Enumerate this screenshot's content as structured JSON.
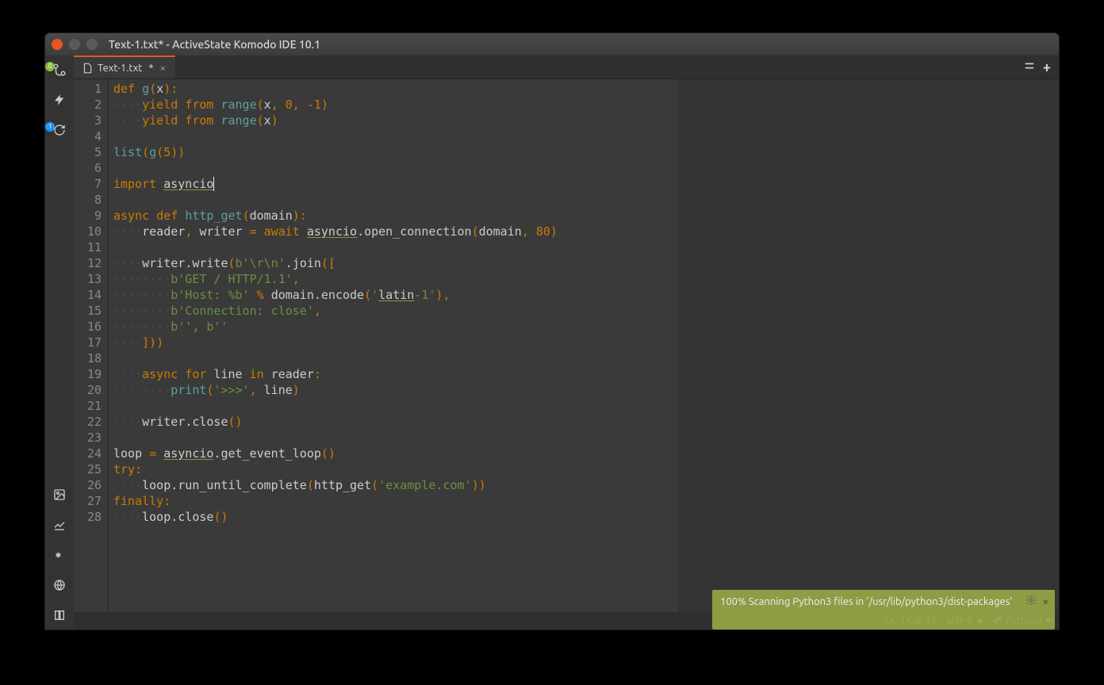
{
  "window": {
    "title": "Text-1.txt* - ActiveState Komodo IDE 10.1"
  },
  "tab": {
    "filename": "Text-1.txt",
    "modified_marker": "*"
  },
  "sidebar": {
    "vcs_badge": "0",
    "notifications_badge": "1"
  },
  "code": {
    "lines": [
      {
        "n": 1,
        "tokens": [
          [
            "kw",
            "def"
          ],
          [
            "plain",
            " "
          ],
          [
            "fn",
            "g"
          ],
          [
            "punc",
            "("
          ],
          [
            "name",
            "x"
          ],
          [
            "punc",
            ")"
          ],
          [
            "punc",
            ":"
          ]
        ]
      },
      {
        "n": 2,
        "tokens": [
          [
            "ws",
            "····"
          ],
          [
            "kw",
            "yield"
          ],
          [
            "plain",
            " "
          ],
          [
            "kw",
            "from"
          ],
          [
            "plain",
            " "
          ],
          [
            "fn",
            "range"
          ],
          [
            "punc",
            "("
          ],
          [
            "name",
            "x"
          ],
          [
            "punc",
            ","
          ],
          [
            "plain",
            " "
          ],
          [
            "num",
            "0"
          ],
          [
            "punc",
            ","
          ],
          [
            "plain",
            " "
          ],
          [
            "op",
            "-"
          ],
          [
            "num",
            "1"
          ],
          [
            "punc",
            ")"
          ]
        ]
      },
      {
        "n": 3,
        "tokens": [
          [
            "ws",
            "····"
          ],
          [
            "kw",
            "yield"
          ],
          [
            "plain",
            " "
          ],
          [
            "kw",
            "from"
          ],
          [
            "plain",
            " "
          ],
          [
            "fn",
            "range"
          ],
          [
            "punc",
            "("
          ],
          [
            "name",
            "x"
          ],
          [
            "punc",
            ")"
          ]
        ]
      },
      {
        "n": 4,
        "tokens": []
      },
      {
        "n": 5,
        "tokens": [
          [
            "fn",
            "list"
          ],
          [
            "punc",
            "("
          ],
          [
            "fn",
            "g"
          ],
          [
            "punc",
            "("
          ],
          [
            "num",
            "5"
          ],
          [
            "punc",
            ")"
          ],
          [
            "punc",
            ")"
          ]
        ]
      },
      {
        "n": 6,
        "tokens": []
      },
      {
        "n": 7,
        "tokens": [
          [
            "kw",
            "import"
          ],
          [
            "plain",
            " "
          ],
          [
            "und",
            "asyncio"
          ]
        ],
        "cursor_after": true
      },
      {
        "n": 8,
        "tokens": []
      },
      {
        "n": 9,
        "tokens": [
          [
            "kw",
            "async"
          ],
          [
            "plain",
            " "
          ],
          [
            "kw",
            "def"
          ],
          [
            "plain",
            " "
          ],
          [
            "fn",
            "http_get"
          ],
          [
            "punc",
            "("
          ],
          [
            "name",
            "domain"
          ],
          [
            "punc",
            ")"
          ],
          [
            "punc",
            ":"
          ]
        ]
      },
      {
        "n": 10,
        "tokens": [
          [
            "ws",
            "····"
          ],
          [
            "name",
            "reader"
          ],
          [
            "punc",
            ","
          ],
          [
            "plain",
            " "
          ],
          [
            "name",
            "writer"
          ],
          [
            "plain",
            " "
          ],
          [
            "op",
            "="
          ],
          [
            "plain",
            " "
          ],
          [
            "kw",
            "await"
          ],
          [
            "plain",
            " "
          ],
          [
            "und",
            "asyncio"
          ],
          [
            "plain",
            "."
          ],
          [
            "name",
            "open_connection"
          ],
          [
            "punc",
            "("
          ],
          [
            "name",
            "domain"
          ],
          [
            "punc",
            ","
          ],
          [
            "plain",
            " "
          ],
          [
            "num",
            "80"
          ],
          [
            "punc",
            ")"
          ]
        ]
      },
      {
        "n": 11,
        "tokens": []
      },
      {
        "n": 12,
        "tokens": [
          [
            "ws",
            "····"
          ],
          [
            "name",
            "writer"
          ],
          [
            "plain",
            "."
          ],
          [
            "name",
            "write"
          ],
          [
            "punc",
            "("
          ],
          [
            "str",
            "b'\\r\\n'"
          ],
          [
            "plain",
            "."
          ],
          [
            "name",
            "join"
          ],
          [
            "punc",
            "("
          ],
          [
            "punc",
            "["
          ]
        ]
      },
      {
        "n": 13,
        "tokens": [
          [
            "ws",
            "········"
          ],
          [
            "str",
            "b'GET / HTTP/1.1'"
          ],
          [
            "punc",
            ","
          ]
        ]
      },
      {
        "n": 14,
        "tokens": [
          [
            "ws",
            "········"
          ],
          [
            "str",
            "b'Host: %b'"
          ],
          [
            "plain",
            " "
          ],
          [
            "op",
            "%"
          ],
          [
            "plain",
            " "
          ],
          [
            "name",
            "domain"
          ],
          [
            "plain",
            "."
          ],
          [
            "name",
            "encode"
          ],
          [
            "punc",
            "("
          ],
          [
            "str",
            "'"
          ],
          [
            "und",
            "latin"
          ],
          [
            "str",
            "-1'"
          ],
          [
            "punc",
            ")"
          ],
          [
            "punc",
            ","
          ]
        ]
      },
      {
        "n": 15,
        "tokens": [
          [
            "ws",
            "········"
          ],
          [
            "str",
            "b'Connection: close'"
          ],
          [
            "punc",
            ","
          ]
        ]
      },
      {
        "n": 16,
        "tokens": [
          [
            "ws",
            "········"
          ],
          [
            "str",
            "b''"
          ],
          [
            "punc",
            ","
          ],
          [
            "plain",
            " "
          ],
          [
            "str",
            "b''"
          ]
        ]
      },
      {
        "n": 17,
        "tokens": [
          [
            "ws",
            "····"
          ],
          [
            "punc",
            "]"
          ],
          [
            "punc",
            ")"
          ],
          [
            "punc",
            ")"
          ]
        ]
      },
      {
        "n": 18,
        "tokens": []
      },
      {
        "n": 19,
        "tokens": [
          [
            "ws",
            "····"
          ],
          [
            "kw",
            "async"
          ],
          [
            "plain",
            " "
          ],
          [
            "kw",
            "for"
          ],
          [
            "plain",
            " "
          ],
          [
            "name",
            "line"
          ],
          [
            "plain",
            " "
          ],
          [
            "kw",
            "in"
          ],
          [
            "plain",
            " "
          ],
          [
            "name",
            "reader"
          ],
          [
            "punc",
            ":"
          ]
        ]
      },
      {
        "n": 20,
        "tokens": [
          [
            "ws",
            "········"
          ],
          [
            "fn",
            "print"
          ],
          [
            "punc",
            "("
          ],
          [
            "str",
            "'>>>'"
          ],
          [
            "punc",
            ","
          ],
          [
            "plain",
            " "
          ],
          [
            "name",
            "line"
          ],
          [
            "punc",
            ")"
          ]
        ]
      },
      {
        "n": 21,
        "tokens": []
      },
      {
        "n": 22,
        "tokens": [
          [
            "ws",
            "····"
          ],
          [
            "name",
            "writer"
          ],
          [
            "plain",
            "."
          ],
          [
            "name",
            "close"
          ],
          [
            "punc",
            "("
          ],
          [
            "punc",
            ")"
          ]
        ]
      },
      {
        "n": 23,
        "tokens": []
      },
      {
        "n": 24,
        "tokens": [
          [
            "name",
            "loop"
          ],
          [
            "plain",
            " "
          ],
          [
            "op",
            "="
          ],
          [
            "plain",
            " "
          ],
          [
            "und",
            "asyncio"
          ],
          [
            "plain",
            "."
          ],
          [
            "name",
            "get_event_loop"
          ],
          [
            "punc",
            "("
          ],
          [
            "punc",
            ")"
          ]
        ]
      },
      {
        "n": 25,
        "tokens": [
          [
            "kw",
            "try"
          ],
          [
            "punc",
            ":"
          ]
        ]
      },
      {
        "n": 26,
        "tokens": [
          [
            "ws",
            "····"
          ],
          [
            "name",
            "loop"
          ],
          [
            "plain",
            "."
          ],
          [
            "name",
            "run_until_complete"
          ],
          [
            "punc",
            "("
          ],
          [
            "name",
            "http_get"
          ],
          [
            "punc",
            "("
          ],
          [
            "str",
            "'example.com'"
          ],
          [
            "punc",
            ")"
          ],
          [
            "punc",
            ")"
          ]
        ]
      },
      {
        "n": 27,
        "tokens": [
          [
            "kw",
            "finally"
          ],
          [
            "punc",
            ":"
          ]
        ]
      },
      {
        "n": 28,
        "tokens": [
          [
            "ws",
            "····"
          ],
          [
            "name",
            "loop"
          ],
          [
            "plain",
            "."
          ],
          [
            "name",
            "close"
          ],
          [
            "punc",
            "("
          ],
          [
            "punc",
            ")"
          ]
        ]
      }
    ]
  },
  "status": {
    "position": "Ln: 7 Col: 15",
    "encoding": "UTF-8",
    "language": "Python3"
  },
  "notification": {
    "text": "100% Scanning Python3 files in '/usr/lib/python3/dist-packages'"
  }
}
